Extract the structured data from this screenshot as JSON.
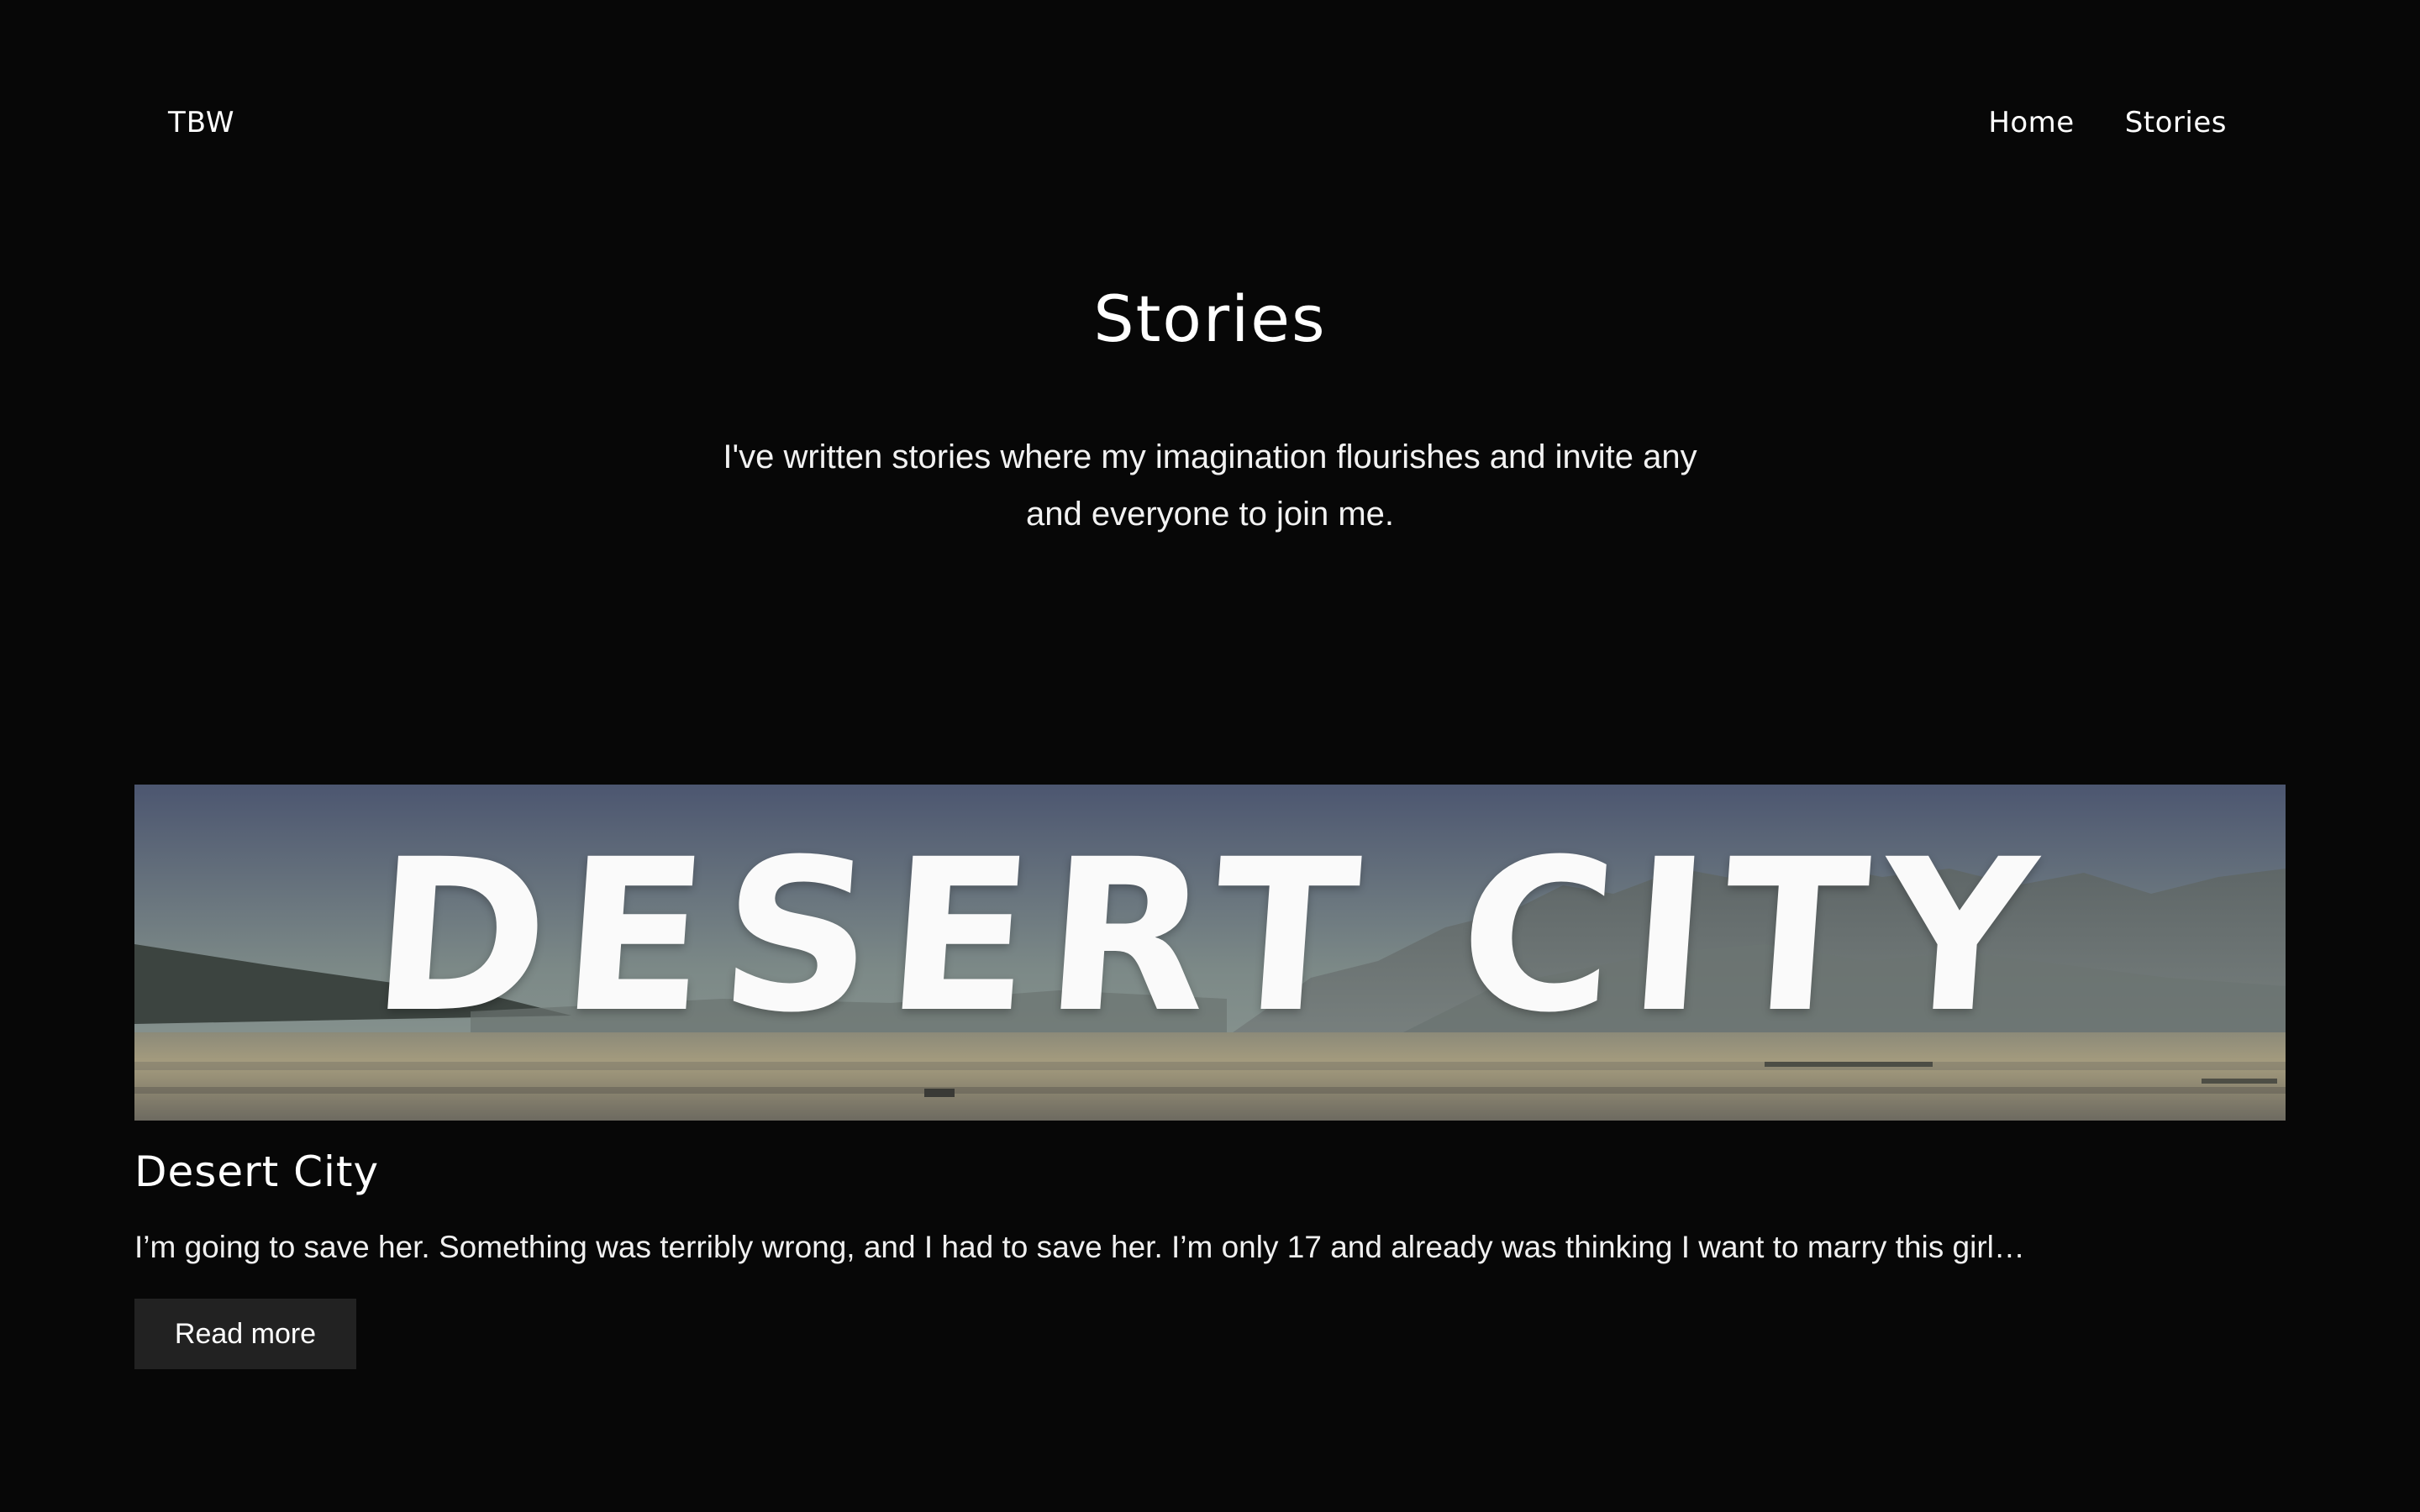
{
  "header": {
    "logo": "TBW",
    "nav": [
      {
        "label": "Home"
      },
      {
        "label": "Stories"
      }
    ]
  },
  "hero": {
    "title": "Stories",
    "description": "I've written stories where my imagination flourishes and invite any and everyone to join me."
  },
  "stories": [
    {
      "banner_text": "DESERT CITY",
      "title": "Desert City",
      "excerpt": "I’m going to save her. Something was terribly wrong, and I had to save her. I’m only 17 and already was thinking I want to marry this girl…",
      "cta": "Read more"
    }
  ],
  "colors": {
    "background": "#070707",
    "button": "#222222",
    "text": "#ffffff"
  }
}
